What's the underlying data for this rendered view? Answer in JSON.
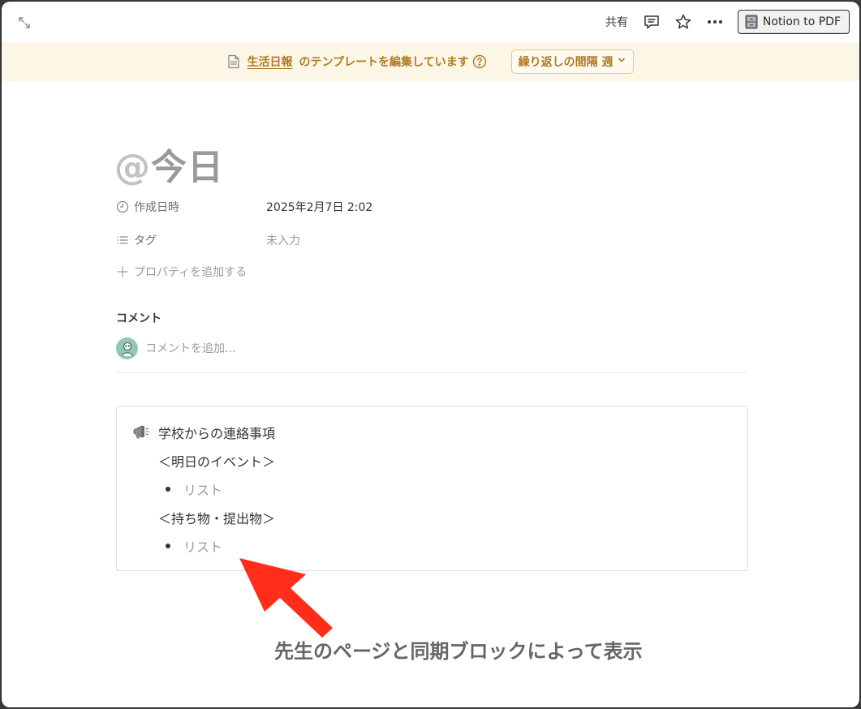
{
  "topbar": {
    "share_label": "共有",
    "pdf_button_label": "Notion to PDF"
  },
  "banner": {
    "template_link": "生活日報",
    "editing_text": "のテンプレートを編集しています",
    "repeat_label": "繰り返しの間隔 週"
  },
  "page": {
    "title_prefix": "@",
    "title": "今日"
  },
  "properties": [
    {
      "name": "作成日時",
      "icon": "clock-icon",
      "value": "2025年2月7日 2:02"
    },
    {
      "name": "タグ",
      "icon": "list-icon",
      "value": "未入力"
    }
  ],
  "add_property_label": "プロパティを追加する",
  "comments": {
    "heading": "コメント",
    "placeholder": "コメントを追加..."
  },
  "synced_block": {
    "icon": "megaphone-icon",
    "heading": "学校からの連絡事項",
    "section1_title": "＜明日のイベント＞",
    "section1_item": "リスト",
    "section2_title": "＜持ち物・提出物＞",
    "section2_item": "リスト"
  },
  "annotation": {
    "text": "先生のページと同期ブロックによって表示",
    "arrow_color": "#ff2d1a"
  },
  "colors": {
    "banner_bg": "#fbf6e6",
    "banner_text": "#b07b22",
    "avatar_bg": "#8fc9b5"
  }
}
